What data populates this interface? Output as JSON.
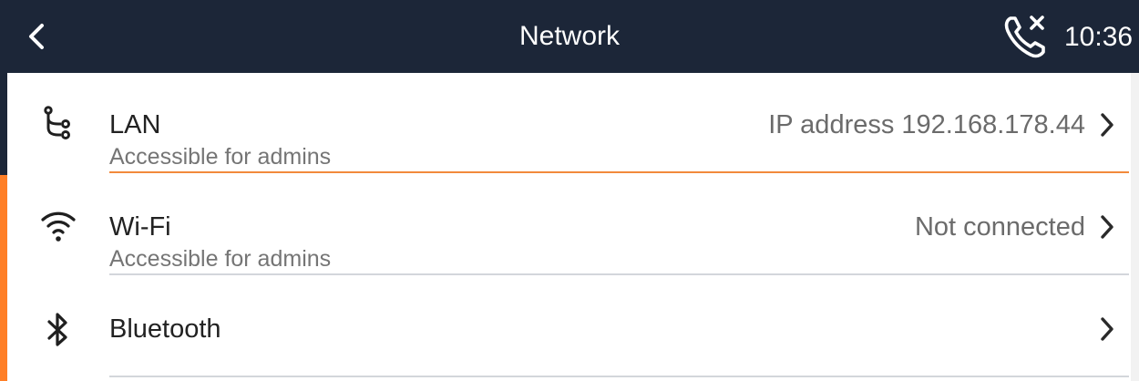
{
  "header": {
    "title": "Network",
    "time": "10:36",
    "back_icon": "chevron-left-icon",
    "status_icon": "call-forward-off-icon"
  },
  "colors": {
    "header_bg": "#1c2638",
    "accent": "#ff7f27",
    "divider": "#d3d6db"
  },
  "items": [
    {
      "label": "LAN",
      "subtitle": "Accessible for admins",
      "value": "IP address 192.168.178.44",
      "icon": "lan-icon",
      "selected": true
    },
    {
      "label": "Wi-Fi",
      "subtitle": "Accessible for admins",
      "value": "Not connected",
      "icon": "wifi-icon",
      "selected": false
    },
    {
      "label": "Bluetooth",
      "subtitle": "",
      "value": "",
      "icon": "bluetooth-icon",
      "selected": false
    }
  ]
}
